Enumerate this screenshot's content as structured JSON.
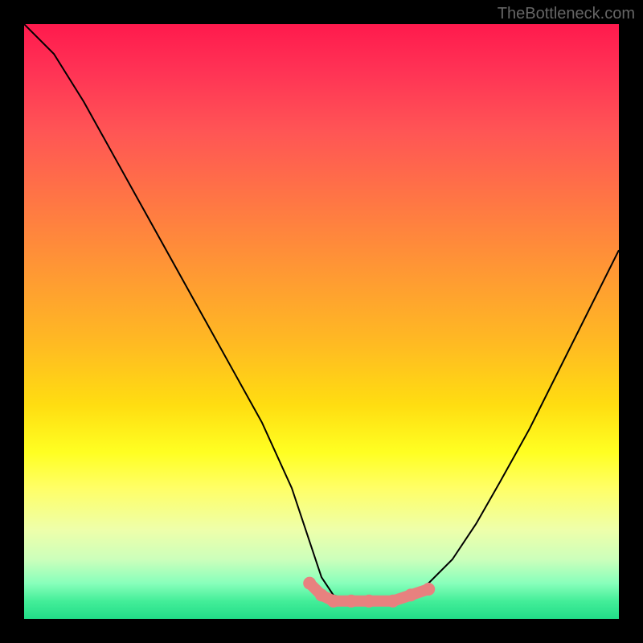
{
  "watermark": "TheBottleneck.com",
  "chart_data": {
    "type": "line",
    "title": "",
    "xlabel": "",
    "ylabel": "",
    "xlim": [
      0,
      100
    ],
    "ylim": [
      0,
      100
    ],
    "series": [
      {
        "name": "bottleneck-curve",
        "x": [
          0,
          5,
          10,
          15,
          20,
          25,
          30,
          35,
          40,
          45,
          48,
          50,
          52,
          55,
          58,
          62,
          65,
          68,
          72,
          76,
          80,
          85,
          90,
          95,
          100
        ],
        "y": [
          100,
          95,
          87,
          78,
          69,
          60,
          51,
          42,
          33,
          22,
          13,
          7,
          4,
          3,
          3,
          3,
          4,
          6,
          10,
          16,
          23,
          32,
          42,
          52,
          62
        ]
      }
    ],
    "markers": {
      "name": "highlight-range",
      "color": "#e8817f",
      "x": [
        48,
        50,
        52,
        55,
        58,
        62,
        65,
        68
      ],
      "y": [
        6,
        4,
        3,
        3,
        3,
        3,
        4,
        5
      ]
    },
    "gradient_stops": [
      {
        "pos": 0,
        "color": "#ff1a4d"
      },
      {
        "pos": 50,
        "color": "#ffcc22"
      },
      {
        "pos": 80,
        "color": "#ffff66"
      },
      {
        "pos": 100,
        "color": "#22dd88"
      }
    ]
  }
}
